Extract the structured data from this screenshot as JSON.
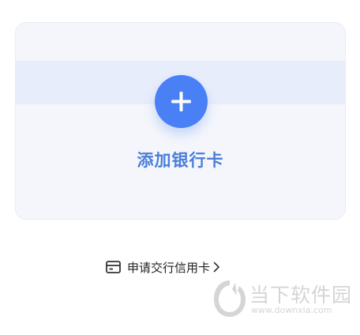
{
  "add_card": {
    "label": "添加银行卡",
    "icon": "plus-icon"
  },
  "apply_link": {
    "label": "申请交行信用卡",
    "icon": "credit-card-icon",
    "chevron": "chevron-right-icon"
  },
  "watermark": {
    "name": "当下软件园",
    "url": "www.downxia.com",
    "icon": "downxia-logo-icon"
  },
  "colors": {
    "accent": "#4a80f5",
    "label": "#4a7ed8",
    "card_bg": "#f4f6fb",
    "band_bg": "#e8edfb"
  }
}
